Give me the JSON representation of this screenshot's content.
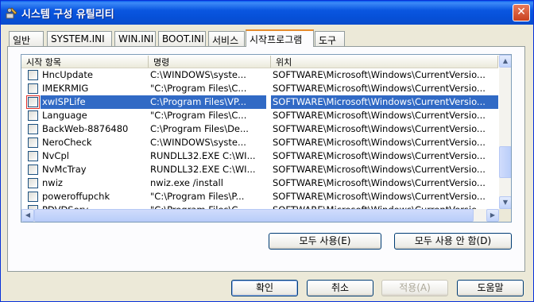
{
  "window": {
    "title": "시스템 구성 유틸리티",
    "close_label": "✕"
  },
  "tabs": [
    {
      "label": "일반"
    },
    {
      "label": "SYSTEM.INI"
    },
    {
      "label": "WIN.INI"
    },
    {
      "label": "BOOT.INI"
    },
    {
      "label": "서비스"
    },
    {
      "label": "시작프로그램"
    },
    {
      "label": "도구"
    }
  ],
  "active_tab": "시작프로그램",
  "listview": {
    "columns": [
      "시작 항목",
      "명령",
      "위치"
    ],
    "rows": [
      {
        "name": "HncUpdate",
        "command": "C:\\WINDOWS\\syste...",
        "location": "SOFTWARE\\Microsoft\\Windows\\CurrentVersio...",
        "checked": false
      },
      {
        "name": "IMEKRMIG",
        "command": "\"C:\\Program Files\\C...",
        "location": "SOFTWARE\\Microsoft\\Windows\\CurrentVersio...",
        "checked": false
      },
      {
        "name": "xwISPLife",
        "command": "C:\\Program Files\\VP...",
        "location": "SOFTWARE\\Microsoft\\Windows\\CurrentVersio...",
        "checked": false
      },
      {
        "name": "Language",
        "command": "\"C:\\Program Files\\C...",
        "location": "SOFTWARE\\Microsoft\\Windows\\CurrentVersio...",
        "checked": false
      },
      {
        "name": "BackWeb-8876480",
        "command": "C:\\Program Files\\De...",
        "location": "SOFTWARE\\Microsoft\\Windows\\CurrentVersio...",
        "checked": false
      },
      {
        "name": "NeroCheck",
        "command": "C:\\WINDOWS\\syste...",
        "location": "SOFTWARE\\Microsoft\\Windows\\CurrentVersio...",
        "checked": false
      },
      {
        "name": "NvCpl",
        "command": "RUNDLL32.EXE C:\\WI...",
        "location": "SOFTWARE\\Microsoft\\Windows\\CurrentVersio...",
        "checked": false
      },
      {
        "name": "NvMcTray",
        "command": "RUNDLL32.EXE C:\\WI...",
        "location": "SOFTWARE\\Microsoft\\Windows\\CurrentVersio...",
        "checked": false
      },
      {
        "name": "nwiz",
        "command": "nwiz.exe /install",
        "location": "SOFTWARE\\Microsoft\\Windows\\CurrentVersio...",
        "checked": false
      },
      {
        "name": "poweroffupchk",
        "command": "\"C:\\Program Files\\P...",
        "location": "SOFTWARE\\Microsoft\\Windows\\CurrentVersio...",
        "checked": false
      },
      {
        "name": "PDVDServ",
        "command": "\"C:\\Program Files\\C...",
        "location": "SOFTWARE\\Microsoft\\Windows\\CurrentVersio...",
        "checked": false
      }
    ],
    "selected_row": 2
  },
  "panel_buttons": {
    "enable_all": "모두 사용(E)",
    "disable_all": "모두 사용 안 함(D)"
  },
  "dialog_buttons": {
    "ok": "확인",
    "cancel": "취소",
    "apply": "적용(A)",
    "help": "도움말"
  },
  "colors": {
    "selection": "#316ac5",
    "titlebar": "#0a56e0",
    "accent_tab": "#e68b2c"
  }
}
